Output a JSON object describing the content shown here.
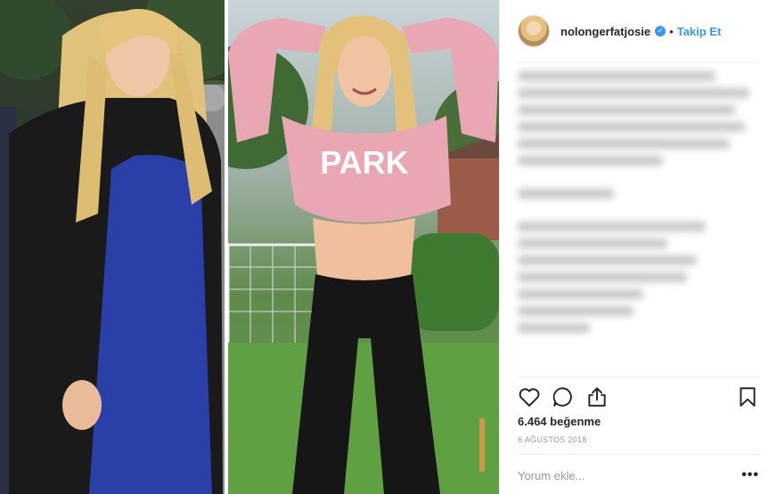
{
  "post": {
    "username": "nolongerfatjosie",
    "separator": "•",
    "follow_label": "Takip Et",
    "likes": "6.464 beğenme",
    "date": "6 AĞUSTOS 2018",
    "comment_placeholder": "Yorum ekle...",
    "more_label": "•••",
    "verified_mark": "✓"
  },
  "photo": {
    "shirt_text": "PARK"
  },
  "icons": {
    "like": "heart-icon",
    "comment": "speech-bubble-icon",
    "share": "share-icon",
    "save": "bookmark-icon",
    "verified": "verified-badge-icon"
  },
  "colors": {
    "link_blue": "#3897f0",
    "text": "#262626",
    "muted": "#999999",
    "divider": "#efefef",
    "sweater_pink": "#e8a7b2",
    "dress_blue": "#2b3fa8"
  }
}
